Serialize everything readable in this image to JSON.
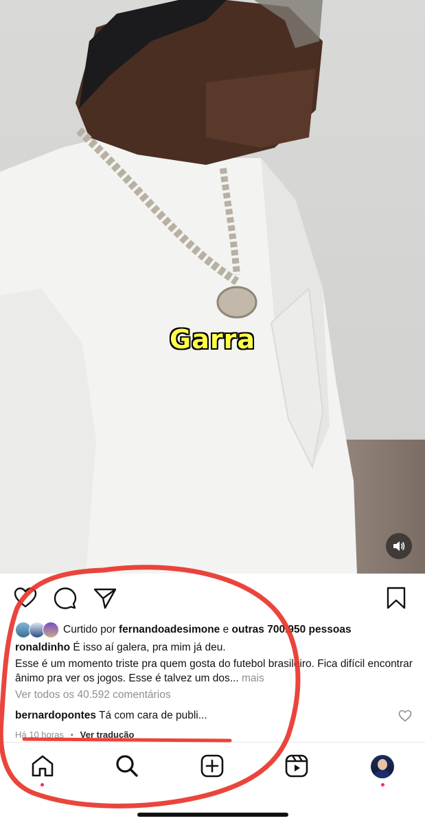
{
  "video": {
    "caption": "Garra"
  },
  "likes": {
    "prefix": "Curtido por",
    "user": "fernandoadesimone",
    "connector": "e",
    "others": "outras 700.950 pessoas"
  },
  "post": {
    "username": "ronaldinho",
    "caption_first_line": "É isso aí galera, pra mim já deu.",
    "caption_body": "Esse é um momento triste pra quem gosta do futebol brasileiro. Fica difícil encontrar ânimo pra ver os jogos. Esse é talvez um dos...",
    "more_label": "mais",
    "view_comments": "Ver todos os 40.592 comentários",
    "comment_user": "bernardopontes",
    "comment_text": "Tá com cara de publi...",
    "time": "Há 10 horas",
    "separator": "•",
    "translate": "Ver tradução"
  },
  "colors": {
    "annotation_red": "#e8352b",
    "caption_yellow": "#ffff4a",
    "notification_dot": "#ff2d55"
  },
  "icons": [
    "speaker-icon",
    "heart-icon",
    "comment-icon",
    "share-icon",
    "bookmark-icon",
    "comment-like-icon",
    "home-icon",
    "search-icon",
    "create-icon",
    "reels-icon",
    "profile-avatar"
  ]
}
